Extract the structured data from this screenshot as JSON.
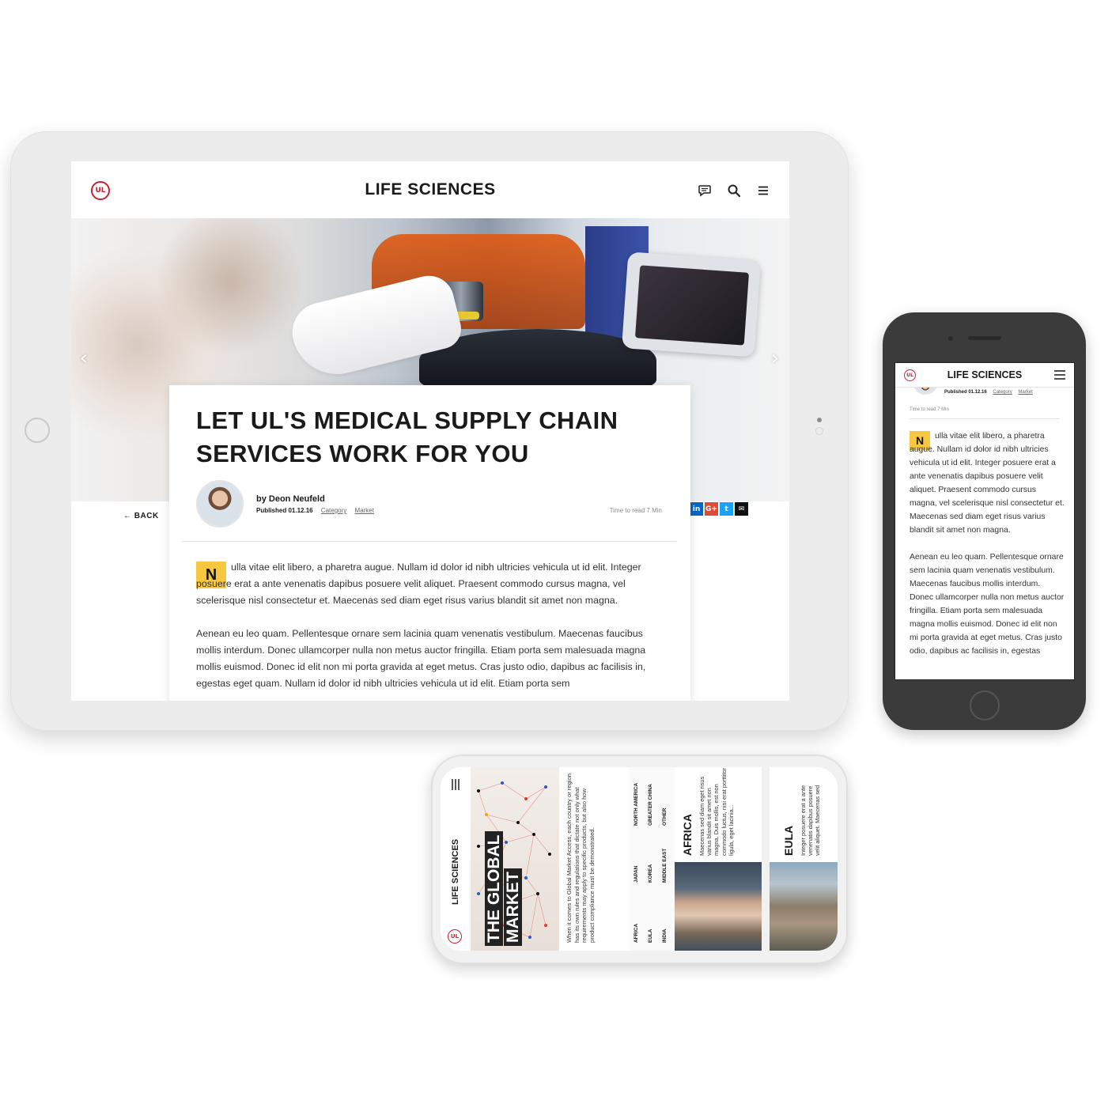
{
  "tablet": {
    "header": {
      "logo_text": "UL",
      "title": "LIFE SCIENCES",
      "icons": [
        "chat-icon",
        "search-icon",
        "menu-icon"
      ]
    },
    "hero": {
      "nav": {
        "prev": "‹",
        "next": "›"
      }
    },
    "back_label": "BACK",
    "social": {
      "linkedin": "in",
      "google": "G+",
      "twitter": "t",
      "email": "✉"
    },
    "article": {
      "headline": "LET UL'S MEDICAL SUPPLY CHAIN SERVICES WORK FOR YOU",
      "author": "by Deon Neufeld",
      "published": "Published 01.12.16",
      "category": "Category",
      "market": "Market",
      "read_time": "Time to read 7 Min",
      "dropcap": "N",
      "paragraph1": "ulla vitae elit libero, a pharetra augue. Nullam id dolor id nibh ultricies vehicula ut id elit. Integer posuere erat a ante venenatis dapibus posuere velit aliquet. Praesent commodo cursus magna, vel scelerisque nisl consectetur et. Maecenas sed diam eget risus varius blandit sit amet non magna.",
      "paragraph2": "Aenean eu leo quam. Pellentesque ornare sem lacinia quam venenatis vestibulum. Maecenas faucibus mollis interdum. Donec ullamcorper nulla non metus auctor fringilla. Etiam porta sem malesuada magna mollis euismod. Donec id elit non mi porta gravida at eget metus. Cras justo odio, dapibus ac facilisis in, egestas eget quam. Nullam id dolor id nibh ultricies vehicula ut id elit. Etiam porta sem"
    }
  },
  "phone": {
    "header": {
      "logo_text": "UL",
      "title": "LIFE SCIENCES"
    },
    "published": "Published 01.12.16",
    "category": "Category",
    "market": "Market",
    "read_time": "Time to read 7 Min",
    "dropcap": "N",
    "paragraph1": "ulla vitae elit libero, a pharetra augue. Nullam id dolor id nibh ultricies vehicula ut id elit. Integer posuere erat a ante venenatis dapibus posuere velit aliquet. Praesent commodo cursus magna, vel scelerisque nisl consectetur et. Maecenas sed diam eget risus varius blandit sit amet non magna.",
    "paragraph2": "Aenean eu leo quam. Pellentesque ornare sem lacinia quam venenatis vestibulum. Maecenas faucibus mollis interdum. Donec ullamcorper nulla non metus auctor fringilla. Etiam porta sem malesuada magna mollis euismod. Donec id elit non mi porta gravida at eget metus. Cras justo odio, dapibus ac facilisis in, egestas"
  },
  "landscape_phone": {
    "logo_text": "UL",
    "side_title": "LIFE SCIENCES",
    "headline_line1": "THE GLOBAL",
    "headline_line2": "MARKET",
    "intro": "When it comes to Global Market Access, each country or region has its own rules and regulations that dictate not only what requirements may apply to specific products, but also how product compliance must be demonstrated.",
    "regions": {
      "col1": [
        "AFRICA",
        "EULA",
        "INDIA"
      ],
      "col2": [
        "JAPAN",
        "KOREA",
        "MIDDLE EAST"
      ],
      "col3": [
        "NORTH AMERICA",
        "GREATER CHINA",
        "OTHER"
      ]
    },
    "cards": [
      {
        "title": "AFRICA",
        "text": "Maecenas sed diam eget risus varius blandit sit amet non magna. Duis mollis, est non commodo luctus, nisi erat porttitor ligula, eget lacinia..."
      },
      {
        "title": "EULA",
        "text": "Integer posuere erat a ante venenatis dapibus posuere velit aliquet. Maecenas sed"
      }
    ]
  },
  "colors": {
    "brand_red": "#c8202e",
    "dropcap_yellow": "#f7c740",
    "linkedin": "#0a66c2",
    "google": "#dd4b39",
    "twitter": "#1da1f2",
    "email": "#111111",
    "phone_body": "#3b3b3b"
  }
}
